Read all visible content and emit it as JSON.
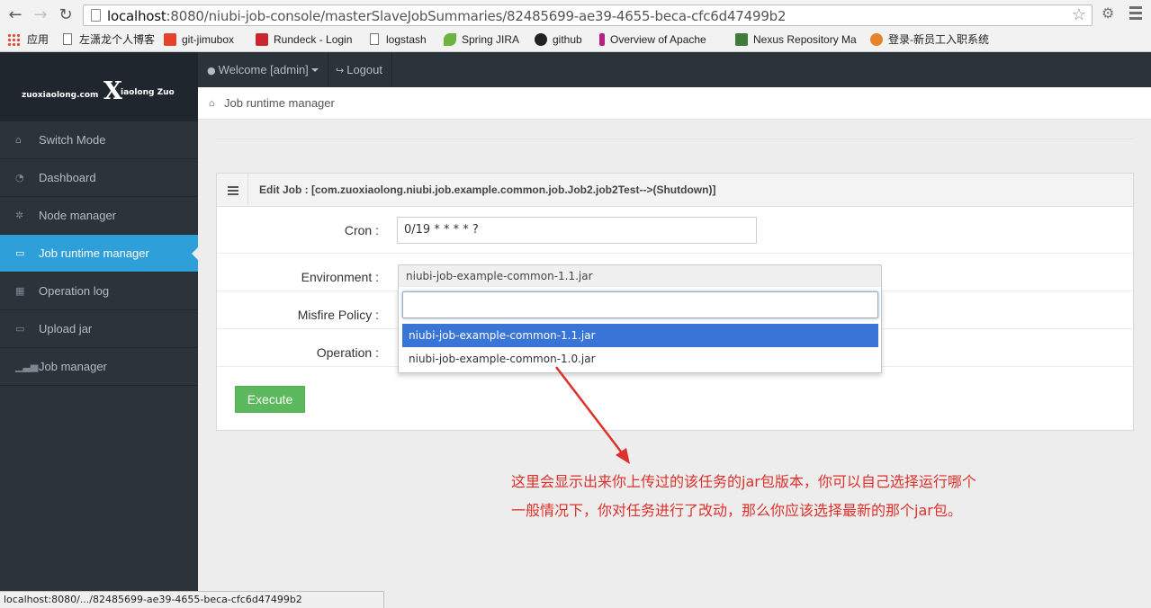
{
  "browser": {
    "url_host": "localhost",
    "url_rest": ":8080/niubi-job-console/masterSlaveJobSummaries/82485699-ae39-4655-beca-cfc6d47499b2",
    "bookmarks": [
      "应用",
      "左潇龙个人博客",
      "git-jimubox",
      "Rundeck - Login",
      "logstash",
      "Spring JIRA",
      "github",
      "Overview of Apache",
      "Nexus Repository Ma",
      "登录-新员工入职系统"
    ],
    "status_url": "localhost:8080/.../82485699-ae39-4655-beca-cfc6d47499b2"
  },
  "brand": {
    "site": "zuoxiaolong.com",
    "logo_letter": "X",
    "logo_text": "iaolong Zuo"
  },
  "topbar": {
    "welcome": "Welcome [admin]",
    "logout": "Logout"
  },
  "sidebar": {
    "items": [
      {
        "label": "Switch Mode"
      },
      {
        "label": "Dashboard"
      },
      {
        "label": "Node manager"
      },
      {
        "label": "Job runtime manager"
      },
      {
        "label": "Operation log"
      },
      {
        "label": "Upload jar"
      },
      {
        "label": "Job manager"
      }
    ]
  },
  "breadcrumb": "Job runtime manager",
  "panel": {
    "title": "Edit Job : [com.zuoxiaolong.niubi.job.example.common.job.Job2.job2Test-->(Shutdown)]",
    "labels": {
      "cron": "Cron :",
      "environment": "Environment :",
      "misfire": "Misfire Policy :",
      "operation": "Operation :"
    },
    "cron_value": "0/19 * * * * ?",
    "environment_selected": "niubi-job-example-common-1.1.jar",
    "environment_search": "",
    "environment_options": [
      "niubi-job-example-common-1.1.jar",
      "niubi-job-example-common-1.0.jar"
    ],
    "execute_label": "Execute"
  },
  "annotation": {
    "line1": "这里会显示出来你上传过的该任务的jar包版本，你可以自己选择运行哪个",
    "line2": "一般情况下，你对任务进行了改动，那么你应该选择最新的那个jar包。",
    "color": "#e0302a"
  },
  "colors": {
    "sidebar_bg": "#2b333b",
    "active": "#2e9fd8",
    "execute": "#5cb85c",
    "selected_option": "#3875d7"
  }
}
